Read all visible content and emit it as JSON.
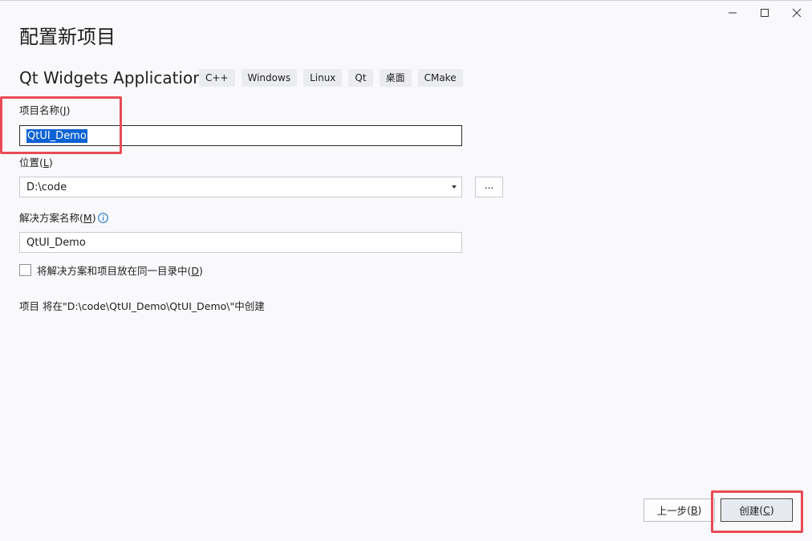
{
  "window": {
    "controls": {
      "minimize_icon": "minimize-icon",
      "maximize_icon": "maximize-icon",
      "close_icon": "close-icon"
    }
  },
  "page": {
    "heading": "配置新项目",
    "app_title": "Qt Widgets Application",
    "tags": [
      "C++",
      "Windows",
      "Linux",
      "Qt",
      "桌面",
      "CMake"
    ]
  },
  "form": {
    "project_name": {
      "label": "项目名称",
      "mnemonic": "J",
      "value": "QtUI_Demo"
    },
    "location": {
      "label": "位置",
      "mnemonic": "L",
      "value": "D:\\code",
      "browse_label": "..."
    },
    "solution_name": {
      "label": "解决方案名称",
      "mnemonic": "M",
      "value": "QtUI_Demo",
      "info_icon": "info-icon"
    },
    "same_dir_checkbox": {
      "label": "将解决方案和项目放在同一目录中",
      "mnemonic": "D",
      "checked": false
    },
    "path_text": "项目 将在\"D:\\code\\QtUI_Demo\\QtUI_Demo\\\"中创建"
  },
  "footer": {
    "back_label": "上一步",
    "back_mnemonic": "B",
    "create_label": "创建",
    "create_mnemonic": "C"
  },
  "colors": {
    "background": "#f9f9fc",
    "selection": "#0b62d4",
    "highlight": "#e94b55",
    "tag_bg": "#ebecf0"
  }
}
